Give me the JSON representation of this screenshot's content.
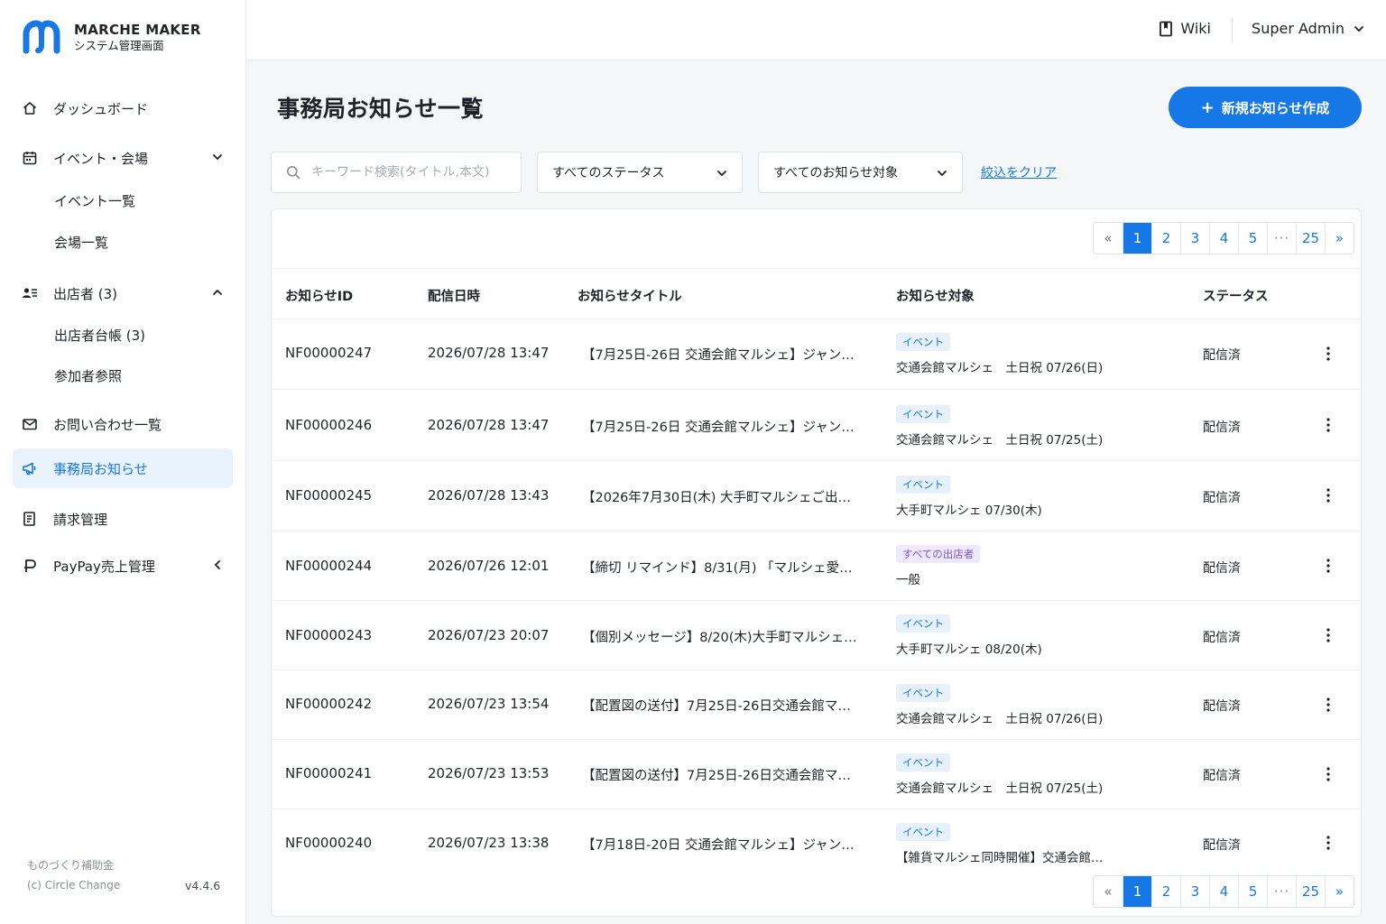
{
  "brand": {
    "title": "MARCHE MAKER",
    "subtitle": "システム管理画面",
    "color": "#1677e6"
  },
  "sidebar": {
    "items": [
      {
        "label": "ダッシュボード",
        "icon": "home-icon"
      },
      {
        "label": "イベント・会場",
        "icon": "calendar-icon",
        "expanded": true
      },
      {
        "label": "イベント一覧"
      },
      {
        "label": "会場一覧"
      },
      {
        "label": "出店者 (3)",
        "icon": "users-icon",
        "expanded": true
      },
      {
        "label": "出店者台帳 (3)"
      },
      {
        "label": "参加者参照"
      },
      {
        "label": "お問い合わせ一覧",
        "icon": "mail-icon"
      },
      {
        "label": "事務局お知らせ",
        "icon": "megaphone-icon",
        "active": true
      },
      {
        "label": "請求管理",
        "icon": "invoice-icon"
      },
      {
        "label": "PayPay売上管理",
        "icon": "paypay-icon",
        "expanded": false
      }
    ],
    "footer": {
      "line1": "ものづくり補助金",
      "line2": "(c) Circle Change",
      "version": "v4.4.6"
    }
  },
  "topbar": {
    "wiki_label": "Wiki",
    "user_label": "Super Admin"
  },
  "main": {
    "title": "事務局お知らせ一覧",
    "new_button": "新規お知らせ作成",
    "search_placeholder": "キーワード検索(タイトル,本文)",
    "status_filter": "すべてのステータス",
    "target_filter": "すべてのお知らせ対象",
    "clear_filters": "絞込をクリア"
  },
  "pagination": {
    "prev": "«",
    "pages": [
      "1",
      "2",
      "3",
      "4",
      "5"
    ],
    "ellipsis": "···",
    "last": "25",
    "next": "»",
    "current": "1"
  },
  "table": {
    "headers": [
      "お知らせID",
      "配信日時",
      "お知らせタイトル",
      "お知らせ対象",
      "ステータス"
    ],
    "rows": [
      {
        "id": "NF00000247",
        "date": "2026/07/28 13:47",
        "title": "【7月25日-26日 交通会館マルシェ】ジャン…",
        "tag": "イベント",
        "target": "交通会館マルシェ　土日祝 07/26(日)",
        "status": "配信済"
      },
      {
        "id": "NF00000246",
        "date": "2026/07/28 13:47",
        "title": "【7月25日-26日 交通会館マルシェ】ジャン…",
        "tag": "イベント",
        "target": "交通会館マルシェ　土日祝 07/25(土)",
        "status": "配信済"
      },
      {
        "id": "NF00000245",
        "date": "2026/07/28 13:43",
        "title": "【2026年7月30日(木) 大手町マルシェご出店…",
        "tag": "イベント",
        "target": "大手町マルシェ 07/30(木)",
        "status": "配信済"
      },
      {
        "id": "NF00000244",
        "date": "2026/07/26 12:01",
        "title": "【締切 リマインド】8/31(月) 「マルシェ愛…",
        "tag": "すべての出店者",
        "target": "一般",
        "status": "配信済"
      },
      {
        "id": "NF00000243",
        "date": "2026/07/23 20:07",
        "title": "【個別メッセージ】8/20(木)大手町マルシェ …",
        "tag": "イベント",
        "target": "大手町マルシェ 08/20(木)",
        "status": "配信済"
      },
      {
        "id": "NF00000242",
        "date": "2026/07/23 13:54",
        "title": "【配置図の送付】7月25日-26日交通会館マル…",
        "tag": "イベント",
        "target": "交通会館マルシェ　土日祝 07/26(日)",
        "status": "配信済"
      },
      {
        "id": "NF00000241",
        "date": "2026/07/23 13:53",
        "title": "【配置図の送付】7月25日-26日交通会館マル…",
        "tag": "イベント",
        "target": "交通会館マルシェ　土日祝 07/25(土)",
        "status": "配信済"
      },
      {
        "id": "NF00000240",
        "date": "2026/07/23 13:38",
        "title": "【7月18日-20日 交通会館マルシェ】ジャン…",
        "tag": "イベント",
        "target": "【雑貨マルシェ同時開催】交通会館マ…",
        "status": "配信済"
      }
    ]
  }
}
